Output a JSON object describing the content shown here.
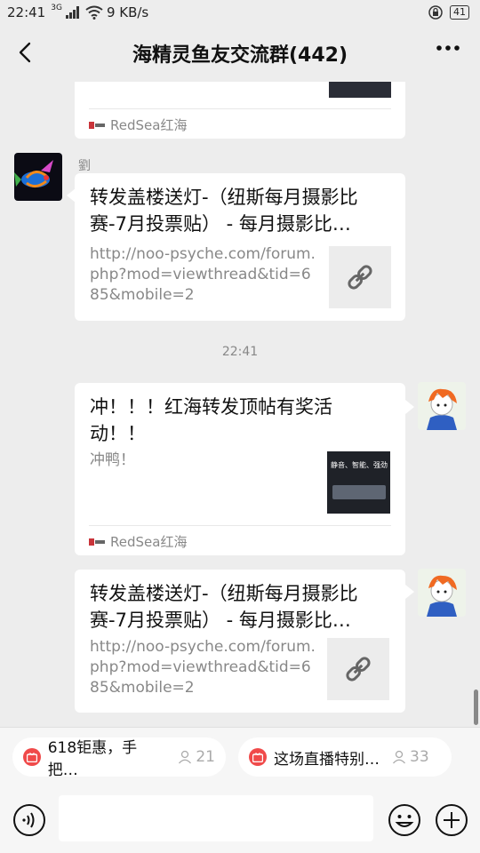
{
  "status_bar": {
    "time": "22:41",
    "signal": "3G",
    "speed": "9 KB/s",
    "battery": "41"
  },
  "nav": {
    "title": "海精灵鱼友交流群(442)"
  },
  "messages": {
    "top_card": {
      "source": "RedSea红海"
    },
    "msg1": {
      "sender": "劉",
      "title": "转发盖楼送灯-（纽斯每月摄影比赛-7月投票贴） - 每月摄影比…",
      "desc": "http://noo-psyche.com/forum.php?mod=viewthread&tid=685&mobile=2"
    },
    "timestamp": "22:41",
    "msg2": {
      "title": "冲！！！红海转发顶帖有奖活动！！",
      "desc": "冲鸭！",
      "thumb_text": "静音、智能、强劲",
      "source": "RedSea红海"
    },
    "msg3": {
      "title": "转发盖楼送灯-（纽斯每月摄影比赛-7月投票贴） - 每月摄影比…",
      "desc": "http://noo-psyche.com/forum.php?mod=viewthread&tid=685&mobile=2"
    }
  },
  "live_chips": [
    {
      "label": "618钜惠，手把…",
      "count": "21"
    },
    {
      "label": "这场直播特别…",
      "count": "33"
    }
  ],
  "colors": {
    "background": "#ededed",
    "bubble": "#ffffff",
    "live_badge": "#f04a4a"
  },
  "icons": {
    "back": "chevron-left-icon",
    "more": "more-dots-icon",
    "link": "link-icon",
    "voice": "voice-icon",
    "emoji": "emoji-icon",
    "plus": "plus-icon",
    "person": "person-icon",
    "live": "live-icon"
  }
}
